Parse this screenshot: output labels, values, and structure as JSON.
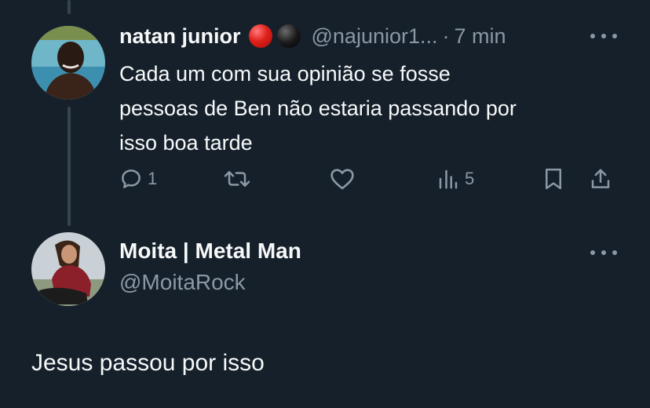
{
  "original_tweet": {
    "display_name": "natan junior",
    "emojis": [
      "red-circle",
      "black-circle"
    ],
    "handle": "@najunior1...",
    "separator": "·",
    "time": "7 min",
    "text_lines": [
      "Cada um com sua opinião se fosse",
      "pessoas de Ben não estaria passando por",
      "isso boa tarde"
    ],
    "actions": {
      "reply_count": "1",
      "retweet_count": "",
      "like_count": "",
      "views_count": "5"
    }
  },
  "reply_composer": {
    "display_name": "Moita | Metal Man",
    "handle": "@MoitaRock",
    "text": "Jesus passou por isso"
  },
  "colors": {
    "background": "#15202b",
    "text_primary": "#f7f9f9",
    "text_secondary": "#8b98a5",
    "thread_line": "#38444d"
  }
}
